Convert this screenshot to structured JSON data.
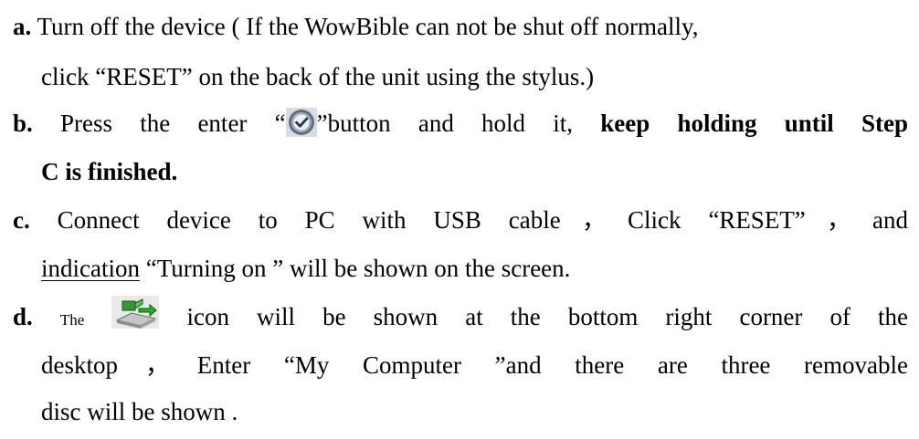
{
  "steps": [
    {
      "marker": "a.",
      "lines": [
        "Turn off the device ( If the WowBible can not be shut off normally,",
        "click “RESET” on the back of the unit using the stylus.)"
      ]
    },
    {
      "marker": "b.",
      "before_icon": "Press the enter “",
      "icon": "enter-check-icon",
      "after_icon": "”button and hold it,",
      "bold_tail": "keep holding until Step",
      "bold_line2": "C is finished."
    },
    {
      "marker": "c.",
      "line1": "Connect device to PC with USB cable，Click “RESET”，and",
      "line2_underlined": "indication",
      "line2_rest": "“Turning on ” will be shown on the screen."
    },
    {
      "marker": "d.",
      "small_word": "The",
      "icon": "usb-removable-device-icon",
      "after_icon": "icon will be shown at the bottom right corner of the",
      "line2": "desktop，Enter “My Computer ”and there are three removable",
      "line3": "disc will be shown ."
    }
  ],
  "colors": {
    "text": "#000000",
    "background": "#ffffff"
  }
}
